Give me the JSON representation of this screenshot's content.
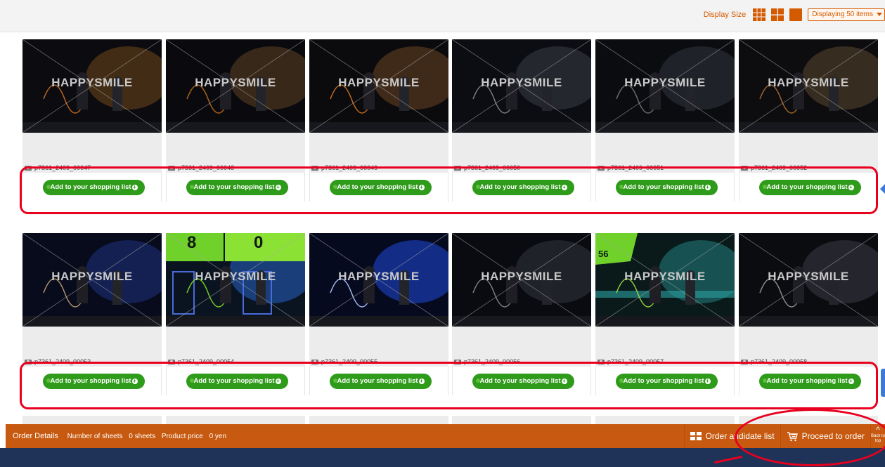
{
  "toolbar": {
    "display_size_label": "Display Size",
    "displaying_label": "Displaying 50 items",
    "accent_color": "#d45a00"
  },
  "watermark": "HAPPYSMILE",
  "button_label": "Add to your shopping list",
  "photos_row1": [
    {
      "id": "p7361_2409_00047"
    },
    {
      "id": "p7361_2409_00048"
    },
    {
      "id": "p7361_2409_00049"
    },
    {
      "id": "p7361_2409_00050"
    },
    {
      "id": "p7361_2409_00051"
    },
    {
      "id": "p7361_2409_00052"
    }
  ],
  "photos_row2": [
    {
      "id": "p7361_2409_00053"
    },
    {
      "id": "p7361_2409_00054",
      "scoreboard": [
        "8",
        "0"
      ]
    },
    {
      "id": "p7361_2409_00055"
    },
    {
      "id": "p7361_2409_00056"
    },
    {
      "id": "p7361_2409_00057",
      "scoreboard": [
        "56"
      ]
    },
    {
      "id": "p7361_2409_00058"
    }
  ],
  "order_bar": {
    "order_details": "Order Details",
    "sheets_label": "Number of sheets",
    "sheets_value": "0 sheets",
    "price_label": "Product price",
    "price_value": "0 yen",
    "candidate_label": "Order candidate list",
    "candidate_visible": "Order andidate list",
    "proceed_label": "Proceed to order",
    "back_top": "Back to top",
    "bar_color": "#c75a10"
  },
  "highlight_color": "#e8001f",
  "button_color": "#2f9b1a"
}
